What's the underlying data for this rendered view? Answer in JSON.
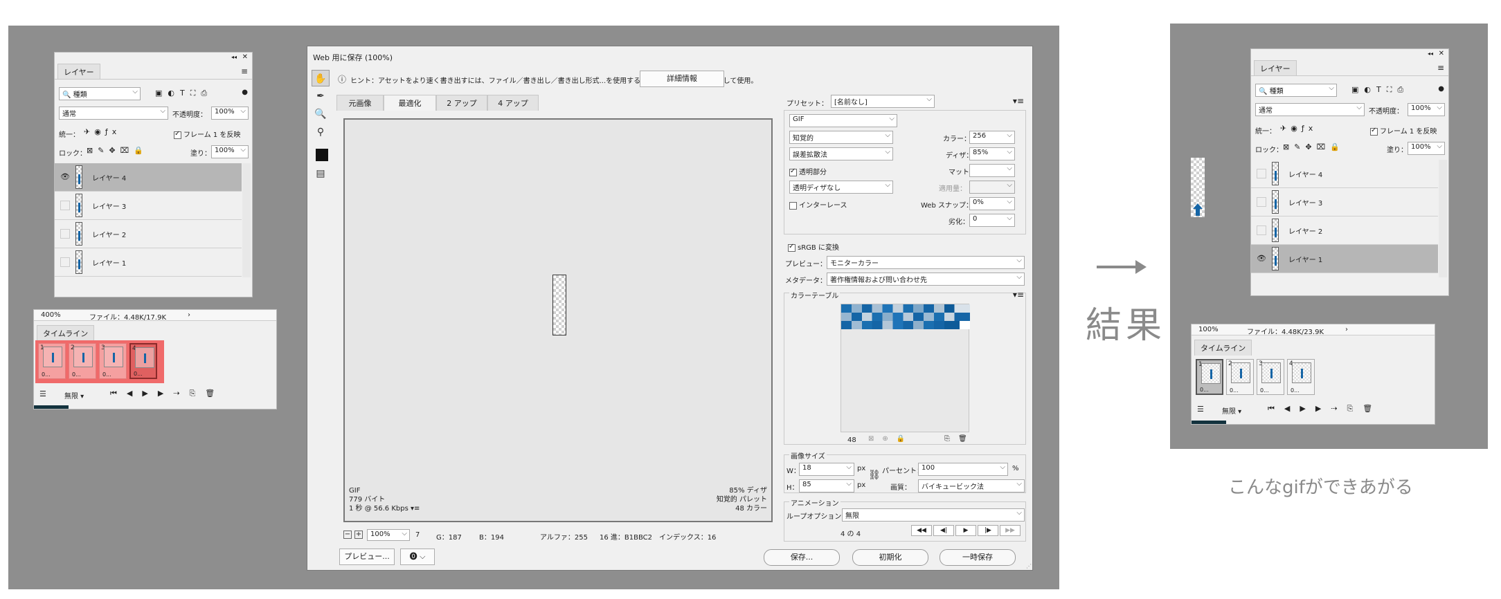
{
  "layers_panel_left": {
    "tab": "レイヤー",
    "kind_filter": "種類",
    "blend_mode": "通常",
    "opacity_label": "不透明度：",
    "opacity_value": "100%",
    "unify_label": "統一：",
    "propagate_label": "フレーム 1 を反映",
    "lock_label": "ロック：",
    "fill_label": "塗り：",
    "fill_value": "100%",
    "layers": [
      {
        "name": "レイヤー 4",
        "visible": true,
        "selected": true
      },
      {
        "name": "レイヤー 3",
        "visible": false,
        "selected": false
      },
      {
        "name": "レイヤー 2",
        "visible": false,
        "selected": false
      },
      {
        "name": "レイヤー 1",
        "visible": false,
        "selected": false
      }
    ]
  },
  "timeline_left": {
    "zoom": "400%",
    "file_info": "ファイル：4.48K/17.9K",
    "tab": "タイムライン",
    "frames": [
      {
        "num": "1",
        "time": "0..."
      },
      {
        "num": "2",
        "time": "0..."
      },
      {
        "num": "3",
        "time": "0..."
      },
      {
        "num": "4",
        "time": "0..."
      }
    ],
    "loop": "無限",
    "highlight_color": "#f06a6a"
  },
  "save_for_web": {
    "title": "Web 用に保存 (100%)",
    "hint": "ヒント：アセットをより速く書き出すには、ファイル／書き出し／書き出し形式...を使用するか、レイヤーを右クリックして使用。",
    "details_button": "詳細情報",
    "tabs": [
      "元画像",
      "最適化",
      "2 アップ",
      "4 アップ"
    ],
    "active_tab_index": 1,
    "preview_info_left": [
      "GIF",
      "779 バイト",
      "1 秒 @ 56.6 Kbps"
    ],
    "preview_info_right": [
      "85% ディザ",
      "知覚的 パレット",
      "48 カラー"
    ],
    "status_bar": {
      "zoom": "100%",
      "r": "7",
      "g": "G：187",
      "b": "B：194",
      "alpha": "アルファ：255",
      "hex": "16 進：B1BBC2",
      "index": "インデックス：16"
    },
    "preview_button": "プレビュー...",
    "save_button": "保存...",
    "reset_button": "初期化",
    "remember_button": "一時保存",
    "settings": {
      "preset_label": "プリセット：",
      "preset_value": "[名前なし]",
      "format": "GIF",
      "reduction": "知覚的",
      "colors_label": "カラー：",
      "colors_value": "256",
      "dither_algo": "誤差拡散法",
      "dither_label": "ディザ：",
      "dither_value": "85%",
      "transparency_label": "透明部分",
      "matte_label": "マット：",
      "trans_dither": "透明ディザなし",
      "amount_label": "適用量：",
      "interlace_label": "インターレース",
      "websnap_label": "Web スナップ：",
      "websnap_value": "0%",
      "lossy_label": "劣化：",
      "lossy_value": "0",
      "srgb_label": "sRGB に変換",
      "preview_label": "プレビュー：",
      "preview_value": "モニターカラー",
      "metadata_label": "メタデータ：",
      "metadata_value": "著作権情報および問い合わせ先",
      "color_table_label": "カラーテーブル",
      "color_count": "48",
      "image_size_label": "画像サイズ",
      "w_label": "W：",
      "w_value": "18",
      "h_label": "H：",
      "h_value": "85",
      "px": "px",
      "percent_label": "パーセント：",
      "percent_value": "100",
      "percent_unit": "%",
      "quality_label": "画質：",
      "quality_value": "バイキュービック法",
      "animation_label": "アニメーション",
      "loop_label": "ループオプション：",
      "loop_value": "無限",
      "frame_counter": "4 の 4"
    }
  },
  "arrow_label": "結果",
  "result": {
    "caption": "こんなgifができあがる",
    "layers_panel": {
      "tab": "レイヤー",
      "kind_filter": "種類",
      "blend_mode": "通常",
      "opacity_label": "不透明度：",
      "opacity_value": "100%",
      "unify_label": "統一：",
      "propagate_label": "フレーム 1 を反映",
      "lock_label": "ロック：",
      "fill_label": "塗り：",
      "fill_value": "100%",
      "layers": [
        {
          "name": "レイヤー 4",
          "visible": false,
          "selected": false
        },
        {
          "name": "レイヤー 3",
          "visible": false,
          "selected": false
        },
        {
          "name": "レイヤー 2",
          "visible": false,
          "selected": false
        },
        {
          "name": "レイヤー 1",
          "visible": true,
          "selected": true
        }
      ]
    },
    "timeline": {
      "zoom": "100%",
      "file_info": "ファイル：4.48K/23.9K",
      "tab": "タイムライン",
      "frames": [
        {
          "num": "1",
          "time": "0..."
        },
        {
          "num": "2",
          "time": "0..."
        },
        {
          "num": "3",
          "time": "0..."
        },
        {
          "num": "4",
          "time": "0..."
        }
      ],
      "loop": "無限"
    }
  }
}
